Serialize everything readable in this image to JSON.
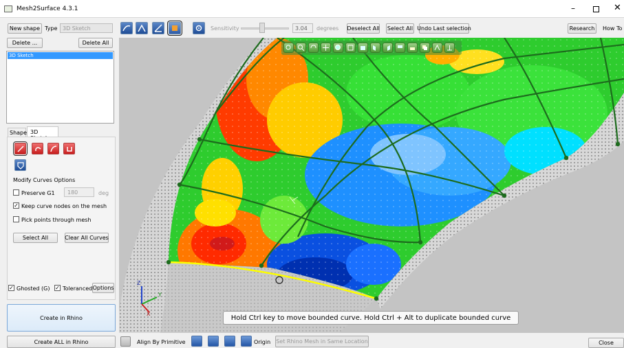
{
  "titlebar": {
    "title": "Mesh2Surface 4.3.1"
  },
  "left": {
    "new_shape": "New shape",
    "type_label": "Type",
    "type_value": "3D Sketch",
    "delete": "Delete ...",
    "delete_all": "Delete All",
    "list_items": [
      "3D Sketch"
    ],
    "tabs": [
      "Shape",
      "3D Sketch"
    ],
    "modify_label": "Modify Curves Options",
    "preserve_g1": "Preserve G1",
    "preserve_value": "180",
    "deg": "deg",
    "keep_nodes": "Keep curve nodes on the mesh",
    "pick_points": "Pick points through mesh",
    "select_all": "Select All",
    "clear_all": "Clear All Curves",
    "ghosted": "Ghosted (G)",
    "toleranced": "Toleranced",
    "options": "Options",
    "create_rhino": "Create in Rhino",
    "create_all": "Create ALL in Rhino"
  },
  "top": {
    "sensitivity": "Sensitivity",
    "sens_value": "3.04",
    "degrees": "degrees",
    "deselect_all": "Deselect All",
    "select_all": "Select All",
    "undo": "Undo Last selection",
    "research": "Research",
    "howto": "How To"
  },
  "viewport": {
    "hint": "Hold Ctrl key to move bounded curve. Hold Ctrl + Alt to duplicate bounded curve",
    "axis_z": "Z",
    "axis_x": "X",
    "axis_y": "Y"
  },
  "bottom": {
    "align": "Align By Primitive",
    "origin": "Origin",
    "set_mesh": "Set Rhino Mesh in Same Location",
    "close": "Close"
  },
  "colors": {
    "selection": "#3399ff",
    "curve_dark": "#1d6b1d",
    "curve_yellow": "#ffff00",
    "viewport_bg": "#c4c4c4"
  }
}
